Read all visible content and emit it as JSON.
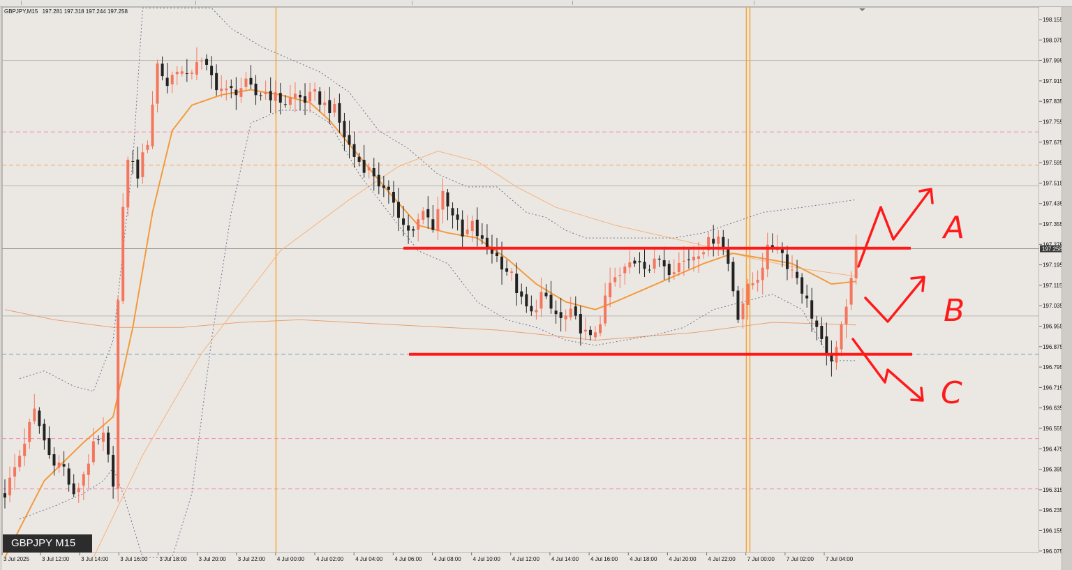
{
  "header": {
    "symbol": "GBPJPY,M15",
    "ohlc": "197.281 197.318 197.244 197.258"
  },
  "symbol_label": "GBPJPY M15",
  "colors": {
    "background": "#ebe8e4",
    "bull": "#f4765c",
    "bear": "#222222",
    "ma_fast": "#f39a3c",
    "ma_slow": "#f6b27a",
    "bands": "#6d6f8f",
    "pink_level": "#f08cb8",
    "orange_level": "#f2a658",
    "blue_level": "#7d95b3",
    "gray_level": "#b9b6b1",
    "separator": "#f5a436",
    "annotation": "#ff1a1a"
  },
  "chart_data": {
    "type": "candlestick",
    "symbol": "GBPJPY",
    "timeframe": "M15",
    "current_price": "197.258",
    "y_ticks": [
      "198.155",
      "198.075",
      "197.995",
      "197.915",
      "197.835",
      "197.755",
      "197.675",
      "197.595",
      "197.515",
      "197.435",
      "197.355",
      "197.275",
      "197.195",
      "197.115",
      "197.035",
      "196.955",
      "196.875",
      "196.795",
      "196.715",
      "196.635",
      "196.555",
      "196.475",
      "196.395",
      "196.315",
      "196.235",
      "196.155",
      "196.075"
    ],
    "ylim": [
      196.075,
      198.185
    ],
    "x_ticks": [
      "3 Jul 2025",
      "3 Jul 12:00",
      "3 Jul 14:00",
      "3 Jul 16:00",
      "3 Jul 18:00",
      "3 Jul 20:00",
      "3 Jul 22:00",
      "4 Jul 00:00",
      "4 Jul 02:00",
      "4 Jul 04:00",
      "4 Jul 06:00",
      "4 Jul 08:00",
      "4 Jul 10:00",
      "4 Jul 12:00",
      "4 Jul 14:00",
      "4 Jul 16:00",
      "4 Jul 18:00",
      "4 Jul 20:00",
      "4 Jul 22:00",
      "7 Jul 00:00",
      "7 Jul 02:00",
      "7 Jul 04:00"
    ],
    "candles_count": 174,
    "price_path": [
      [
        0,
        196.3
      ],
      [
        3,
        196.45
      ],
      [
        6,
        196.62
      ],
      [
        9,
        196.45
      ],
      [
        12,
        196.4
      ],
      [
        14,
        196.28
      ],
      [
        16,
        196.38
      ],
      [
        18,
        196.48
      ],
      [
        20,
        196.52
      ],
      [
        22,
        196.35
      ],
      [
        23,
        197.05
      ],
      [
        24,
        197.4
      ],
      [
        25,
        197.62
      ],
      [
        27,
        197.55
      ],
      [
        29,
        197.68
      ],
      [
        31,
        197.98
      ],
      [
        33,
        197.9
      ],
      [
        35,
        197.97
      ],
      [
        37,
        197.92
      ],
      [
        39,
        198.0
      ],
      [
        41,
        197.96
      ],
      [
        43,
        197.9
      ],
      [
        45,
        197.87
      ],
      [
        47,
        197.88
      ],
      [
        49,
        197.9
      ],
      [
        51,
        197.86
      ],
      [
        53,
        197.87
      ],
      [
        55,
        197.85
      ],
      [
        57,
        197.83
      ],
      [
        59,
        197.86
      ],
      [
        61,
        197.84
      ],
      [
        63,
        197.86
      ],
      [
        65,
        197.82
      ],
      [
        67,
        197.8
      ],
      [
        69,
        197.7
      ],
      [
        71,
        197.62
      ],
      [
        73,
        197.58
      ],
      [
        75,
        197.55
      ],
      [
        77,
        197.48
      ],
      [
        79,
        197.45
      ],
      [
        81,
        197.35
      ],
      [
        83,
        197.32
      ],
      [
        85,
        197.4
      ],
      [
        87,
        197.35
      ],
      [
        89,
        197.48
      ],
      [
        91,
        197.4
      ],
      [
        93,
        197.3
      ],
      [
        95,
        197.35
      ],
      [
        97,
        197.28
      ],
      [
        99,
        197.25
      ],
      [
        101,
        197.2
      ],
      [
        103,
        197.15
      ],
      [
        105,
        197.05
      ],
      [
        107,
        197.0
      ],
      [
        109,
        197.08
      ],
      [
        111,
        197.02
      ],
      [
        113,
        196.98
      ],
      [
        115,
        197.0
      ],
      [
        117,
        196.95
      ],
      [
        119,
        196.9
      ],
      [
        121,
        196.98
      ],
      [
        123,
        197.12
      ],
      [
        125,
        197.15
      ],
      [
        127,
        197.2
      ],
      [
        129,
        197.22
      ],
      [
        131,
        197.18
      ],
      [
        133,
        197.22
      ],
      [
        135,
        197.18
      ],
      [
        137,
        197.2
      ],
      [
        139,
        197.22
      ],
      [
        141,
        197.25
      ],
      [
        143,
        197.28
      ],
      [
        145,
        197.32
      ],
      [
        147,
        197.2
      ],
      [
        149,
        197.0
      ],
      [
        151,
        197.1
      ],
      [
        153,
        197.15
      ],
      [
        155,
        197.25
      ],
      [
        157,
        197.28
      ],
      [
        159,
        197.2
      ],
      [
        161,
        197.15
      ],
      [
        163,
        197.05
      ],
      [
        165,
        196.95
      ],
      [
        167,
        196.82
      ],
      [
        169,
        196.85
      ],
      [
        171,
        197.05
      ],
      [
        173,
        197.27
      ]
    ],
    "ma_fast_path": [
      [
        0,
        196.05
      ],
      [
        8,
        196.35
      ],
      [
        16,
        196.5
      ],
      [
        22,
        196.6
      ],
      [
        26,
        196.95
      ],
      [
        30,
        197.4
      ],
      [
        34,
        197.72
      ],
      [
        38,
        197.82
      ],
      [
        44,
        197.86
      ],
      [
        50,
        197.88
      ],
      [
        56,
        197.86
      ],
      [
        62,
        197.83
      ],
      [
        66,
        197.76
      ],
      [
        72,
        197.62
      ],
      [
        78,
        197.48
      ],
      [
        84,
        197.35
      ],
      [
        90,
        197.32
      ],
      [
        96,
        197.3
      ],
      [
        102,
        197.22
      ],
      [
        108,
        197.12
      ],
      [
        114,
        197.05
      ],
      [
        120,
        197.02
      ],
      [
        124,
        197.05
      ],
      [
        130,
        197.1
      ],
      [
        136,
        197.15
      ],
      [
        142,
        197.2
      ],
      [
        148,
        197.24
      ],
      [
        154,
        197.22
      ],
      [
        160,
        197.2
      ],
      [
        164,
        197.16
      ],
      [
        168,
        197.12
      ],
      [
        173,
        197.13
      ]
    ],
    "ma_mid_path": [
      [
        18,
        196.05
      ],
      [
        28,
        196.45
      ],
      [
        40,
        196.85
      ],
      [
        56,
        197.25
      ],
      [
        70,
        197.45
      ],
      [
        80,
        197.58
      ],
      [
        88,
        197.64
      ],
      [
        96,
        197.6
      ],
      [
        104,
        197.5
      ],
      [
        112,
        197.42
      ],
      [
        124,
        197.35
      ],
      [
        140,
        197.28
      ],
      [
        152,
        197.22
      ],
      [
        162,
        197.18
      ],
      [
        173,
        197.15
      ]
    ],
    "ma_slow_path": [
      [
        0,
        197.02
      ],
      [
        10,
        196.98
      ],
      [
        22,
        196.95
      ],
      [
        36,
        196.95
      ],
      [
        48,
        196.97
      ],
      [
        60,
        196.98
      ],
      [
        80,
        196.96
      ],
      [
        100,
        196.94
      ],
      [
        120,
        196.9
      ],
      [
        140,
        196.93
      ],
      [
        156,
        196.97
      ],
      [
        173,
        196.96
      ]
    ],
    "band_upper_path": [
      [
        3,
        196.75
      ],
      [
        8,
        196.78
      ],
      [
        14,
        196.72
      ],
      [
        18,
        196.7
      ],
      [
        22,
        196.9
      ],
      [
        26,
        197.6
      ],
      [
        28,
        198.2
      ],
      [
        33,
        198.2
      ],
      [
        42,
        198.2
      ],
      [
        46,
        198.12
      ],
      [
        52,
        198.05
      ],
      [
        58,
        198.0
      ],
      [
        64,
        197.95
      ],
      [
        70,
        197.87
      ],
      [
        76,
        197.72
      ],
      [
        82,
        197.65
      ],
      [
        88,
        197.55
      ],
      [
        94,
        197.5
      ],
      [
        100,
        197.5
      ],
      [
        106,
        197.4
      ],
      [
        110,
        197.38
      ],
      [
        114,
        197.33
      ],
      [
        118,
        197.3
      ],
      [
        124,
        197.3
      ],
      [
        130,
        197.3
      ],
      [
        136,
        197.3
      ],
      [
        142,
        197.32
      ],
      [
        148,
        197.36
      ],
      [
        154,
        197.4
      ],
      [
        162,
        197.42
      ],
      [
        173,
        197.45
      ]
    ],
    "band_lower_path": [
      [
        3,
        196.2
      ],
      [
        10,
        196.25
      ],
      [
        16,
        196.3
      ],
      [
        20,
        196.35
      ],
      [
        22,
        196.4
      ],
      [
        24,
        196.3
      ],
      [
        28,
        196.05
      ],
      [
        34,
        196.05
      ],
      [
        38,
        196.3
      ],
      [
        42,
        196.9
      ],
      [
        46,
        197.4
      ],
      [
        50,
        197.75
      ],
      [
        56,
        197.8
      ],
      [
        62,
        197.8
      ],
      [
        66,
        197.75
      ],
      [
        72,
        197.55
      ],
      [
        78,
        197.4
      ],
      [
        84,
        197.25
      ],
      [
        90,
        197.2
      ],
      [
        96,
        197.05
      ],
      [
        102,
        196.98
      ],
      [
        108,
        196.95
      ],
      [
        114,
        196.9
      ],
      [
        120,
        196.88
      ],
      [
        126,
        196.9
      ],
      [
        132,
        196.92
      ],
      [
        138,
        196.95
      ],
      [
        144,
        197.02
      ],
      [
        150,
        197.05
      ],
      [
        156,
        197.08
      ],
      [
        162,
        197.02
      ],
      [
        168,
        196.82
      ],
      [
        173,
        196.82
      ]
    ],
    "horizontal_levels": [
      {
        "price": 197.715,
        "style": "dashed",
        "color": "pink_level"
      },
      {
        "price": 197.585,
        "style": "dashed",
        "color": "orange_level"
      },
      {
        "price": 197.995,
        "style": "solid",
        "color": "gray_level"
      },
      {
        "price": 197.505,
        "style": "solid",
        "color": "gray_level"
      },
      {
        "price": 196.995,
        "style": "solid",
        "color": "gray_level"
      },
      {
        "price": 196.845,
        "style": "dashed",
        "color": "blue_level"
      },
      {
        "price": 196.515,
        "style": "dashed",
        "color": "pink_level"
      },
      {
        "price": 196.318,
        "style": "dashed",
        "color": "pink_level"
      },
      {
        "price": 197.258,
        "style": "solid",
        "color": "current"
      }
    ],
    "day_separators": [
      "4 Jul 00:00",
      "7 Jul 00:00"
    ],
    "annotations": {
      "resistance_line_price": 197.26,
      "support_line_price": 196.845,
      "scenario_labels": [
        "A",
        "B",
        "C"
      ]
    }
  }
}
